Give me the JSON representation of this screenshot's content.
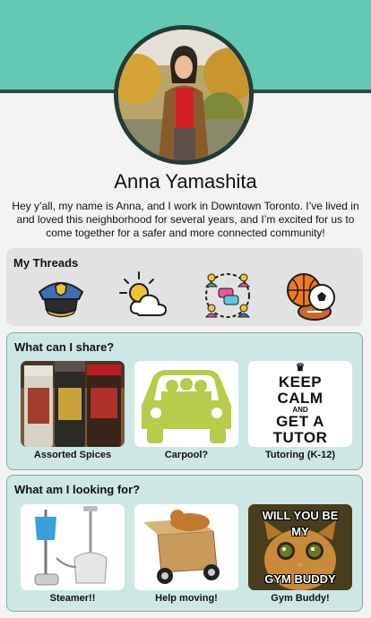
{
  "profile": {
    "name": "Anna Yamashita",
    "bio": "Hey y’all, my name is Anna, and I work in Downtown Toronto. I’ve lived in and loved this neighborhood for several years, and I’m excited for us to come together for a safer and more connected community!"
  },
  "threads": {
    "title": "My Threads",
    "icons": [
      "police-hat-icon",
      "weather-icon",
      "community-icon",
      "sports-balls-icon"
    ]
  },
  "share": {
    "title": "What can I share?",
    "items": [
      {
        "label": "Assorted Spices"
      },
      {
        "label": "Carpool?"
      },
      {
        "label": "Tutoring (K-12)"
      }
    ]
  },
  "tutor_poster": {
    "line1": "KEEP",
    "line2": "CALM",
    "line3": "AND",
    "line4": "GET A",
    "line5": "TUTOR"
  },
  "looking": {
    "title": "What am I looking for?",
    "items": [
      {
        "label": "Steamer!!"
      },
      {
        "label": "Help moving!"
      },
      {
        "label": "Gym Buddy!"
      }
    ]
  },
  "gym_meme": {
    "top": "WILL YOU BE",
    "mid": "MY",
    "bottom": "GYM BUDDY"
  },
  "colors": {
    "header": "#63c9b4",
    "panel_teal": "#cde8e4",
    "panel_grey": "#e2e2e2"
  }
}
